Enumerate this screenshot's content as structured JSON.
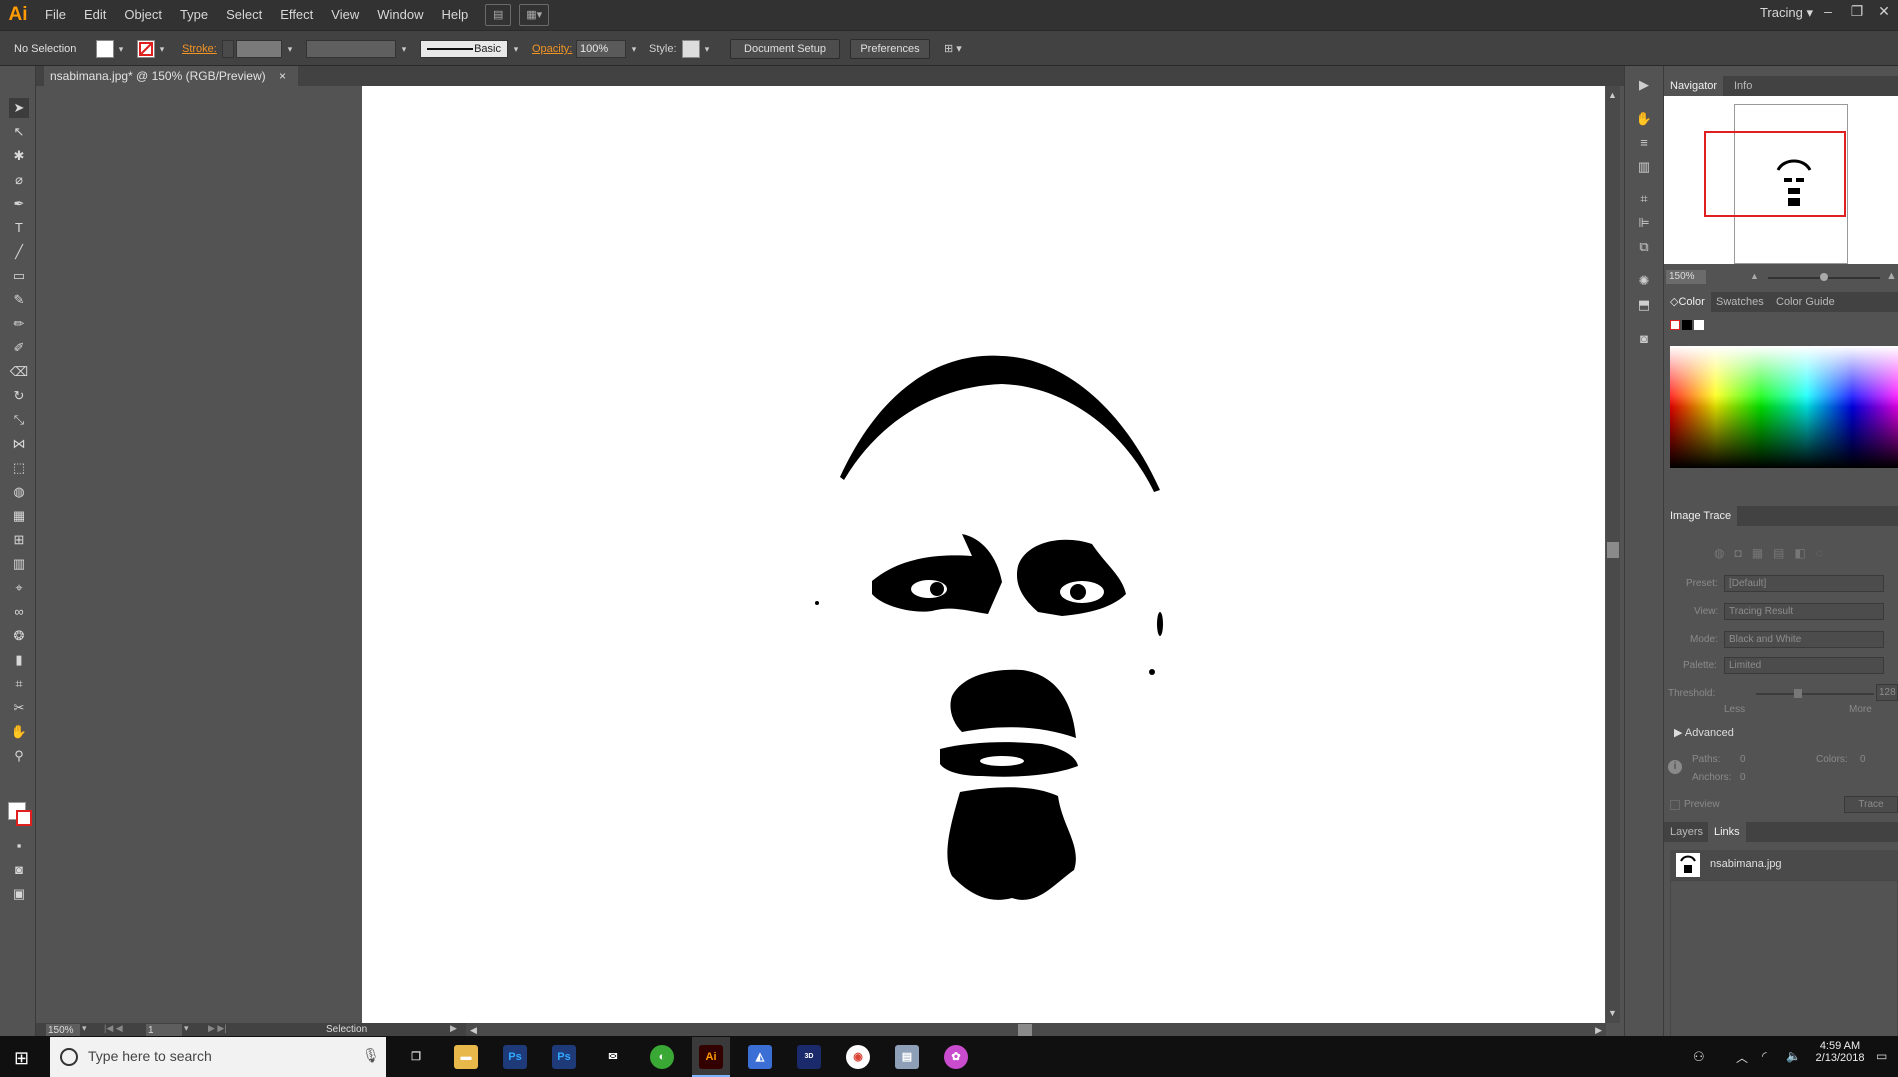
{
  "app": {
    "logo": "Ai",
    "menus": [
      "File",
      "Edit",
      "Object",
      "Type",
      "Select",
      "Effect",
      "View",
      "Window",
      "Help"
    ],
    "workspace": "Tracing"
  },
  "control_bar": {
    "selection_label": "No Selection",
    "stroke_label": "Stroke:",
    "brush_label": "Basic",
    "opacity_label": "Opacity:",
    "opacity_value": "100%",
    "style_label": "Style:",
    "document_setup": "Document Setup",
    "preferences": "Preferences"
  },
  "document": {
    "tab_title": "nsabimana.jpg* @ 150% (RGB/Preview)",
    "zoom": "150%",
    "page": "1",
    "tool_status": "Selection"
  },
  "navigator": {
    "tabs": [
      "Navigator",
      "Info"
    ],
    "zoom": "150%"
  },
  "color_panel": {
    "tabs": [
      "Color",
      "Swatches",
      "Color Guide"
    ]
  },
  "image_trace": {
    "title": "Image Trace",
    "preset_label": "Preset:",
    "preset_value": "[Default]",
    "view_label": "View:",
    "view_value": "Tracing Result",
    "mode_label": "Mode:",
    "mode_value": "Black and White",
    "palette_label": "Palette:",
    "palette_value": "Limited",
    "threshold_label": "Threshold:",
    "threshold_value": "128",
    "less": "Less",
    "more": "More",
    "advanced": "Advanced",
    "paths_label": "Paths:",
    "paths_value": "0",
    "colors_label": "Colors:",
    "colors_value": "0",
    "anchors_label": "Anchors:",
    "anchors_value": "0",
    "preview": "Preview",
    "trace": "Trace"
  },
  "links_panel": {
    "tabs": [
      "Layers",
      "Links"
    ],
    "file": "nsabimana.jpg"
  },
  "taskbar": {
    "search_placeholder": "Type here to search",
    "time": "4:59 AM",
    "date": "2/13/2018"
  },
  "colors": {
    "accent": "#ff9a00",
    "chrome_dark": "#323232",
    "panel": "#535353",
    "nav_box": "#e02020"
  }
}
